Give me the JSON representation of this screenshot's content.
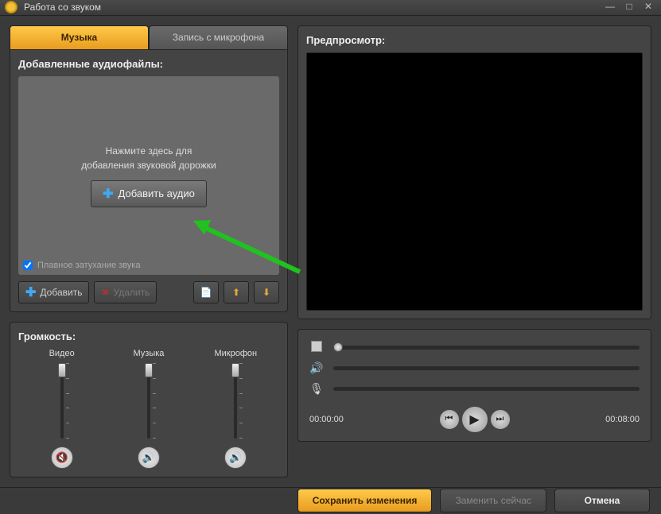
{
  "window": {
    "title": "Работа со звуком"
  },
  "tabs": {
    "music": "Музыка",
    "mic": "Запись с микрофона"
  },
  "added": {
    "title": "Добавленные аудиофайлы:",
    "hint_line1": "Нажмите здесь для",
    "hint_line2": "добавления звуковой дорожки",
    "add_button": "Добавить аудио",
    "fade_label": "Плавное затухание звука"
  },
  "filerow": {
    "add": "Добавить",
    "delete": "Удалить"
  },
  "volume": {
    "title": "Громкость:",
    "video": "Видео",
    "music": "Музыка",
    "mic": "Микрофон"
  },
  "preview": {
    "title": "Предпросмотр:"
  },
  "time": {
    "current": "00:00:00",
    "total": "00:08:00"
  },
  "bottom": {
    "save": "Сохранить изменения",
    "replace": "Заменить сейчас",
    "cancel": "Отмена"
  }
}
